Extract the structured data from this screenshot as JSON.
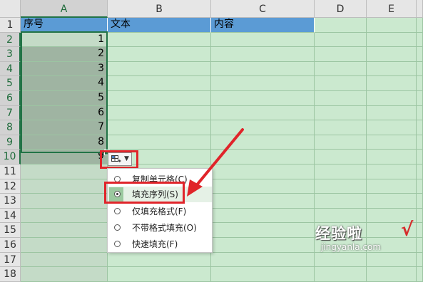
{
  "columns": [
    "A",
    "B",
    "C",
    "D",
    "E"
  ],
  "row_numbers": [
    "1",
    "2",
    "3",
    "4",
    "5",
    "6",
    "7",
    "8",
    "9",
    "10",
    "11",
    "12",
    "13",
    "14",
    "15",
    "16",
    "17",
    "18"
  ],
  "header_row": {
    "a": "序号",
    "b": "文本",
    "c": "内容"
  },
  "sequence_values": [
    "1",
    "2",
    "3",
    "4",
    "5",
    "6",
    "7",
    "8",
    "9"
  ],
  "autofill_menu": {
    "items": [
      {
        "label": "复制单元格(C)",
        "selected": false
      },
      {
        "label": "填充序列(S)",
        "selected": true
      },
      {
        "label": "仅填充格式(F)",
        "selected": false
      },
      {
        "label": "不带格式填充(O)",
        "selected": false
      },
      {
        "label": "快速填充(F)",
        "selected": false
      }
    ]
  },
  "watermark": {
    "text": "经验啦",
    "check": "√",
    "url": "jingyanla.com"
  },
  "colors": {
    "cell_fill": "#cbe9cf",
    "header_fill": "#5b9bd5",
    "selection_border": "#217346",
    "highlight_red": "#e0242a"
  }
}
